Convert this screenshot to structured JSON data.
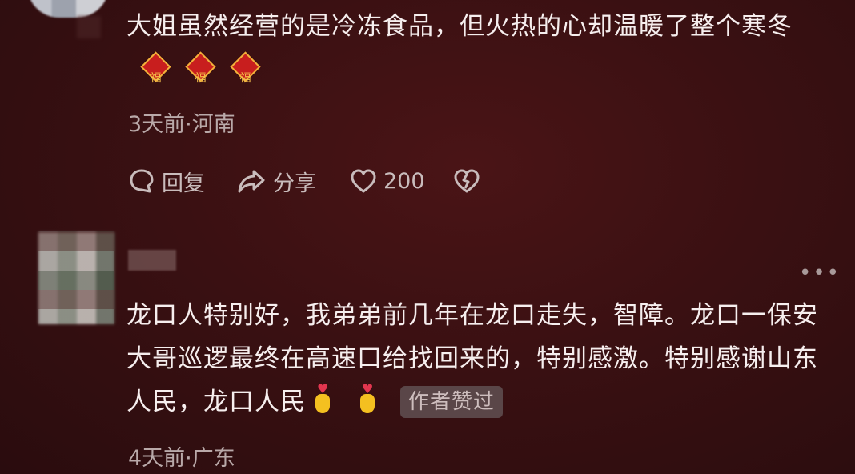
{
  "comments": [
    {
      "text": "大姐虽然经营的是冷冻食品，但火热的心却温暖了整个寒冬",
      "emoji_glyph": "福",
      "meta": "3天前·河南",
      "actions": {
        "reply": "回复",
        "share": "分享",
        "likes": "200"
      }
    },
    {
      "text": "龙口人特别好，我弟弟前几年在龙口走失，智障。龙口一保安大哥巡逻最终在高速口给找回来的，特别感激。特别感谢山东人民，龙口人民",
      "badge": "作者赞过",
      "meta": "4天前·广东",
      "more": "•••"
    }
  ],
  "colors": {
    "background": "#3a1012",
    "text": "#f6eeee",
    "muted": "#b9a9a9",
    "badge_bg": "#5a4648"
  }
}
